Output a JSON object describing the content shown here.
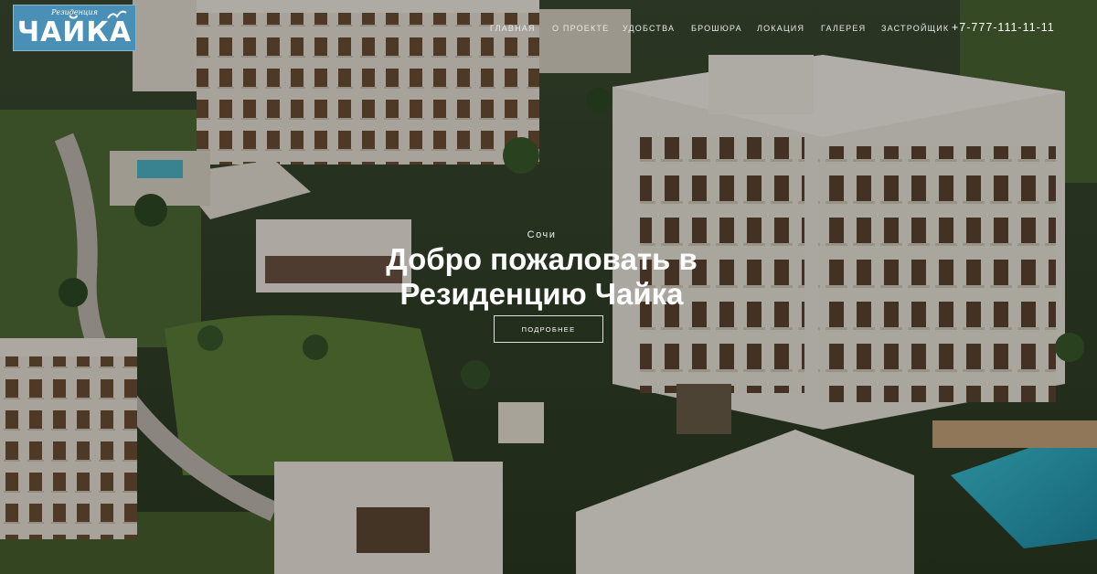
{
  "brand": {
    "tagline": "Резиденция",
    "name": "ЧАЙКА",
    "logo_color": "#4a8fb6"
  },
  "nav": {
    "items": [
      {
        "label": "Главная"
      },
      {
        "label": "О проекте"
      },
      {
        "label": "Удобства"
      },
      {
        "label": "Брошюра"
      },
      {
        "label": "Локация"
      },
      {
        "label": "Галерея"
      },
      {
        "label": "Застройщик"
      }
    ],
    "phone": "+7-777-111-11-11"
  },
  "hero": {
    "city": "Сочи",
    "title_line1": "Добро пожаловать в",
    "title_line2": "Резиденцию Чайка",
    "button_label": "Подробнее",
    "background": "aerial-render-of-residential-complex"
  }
}
